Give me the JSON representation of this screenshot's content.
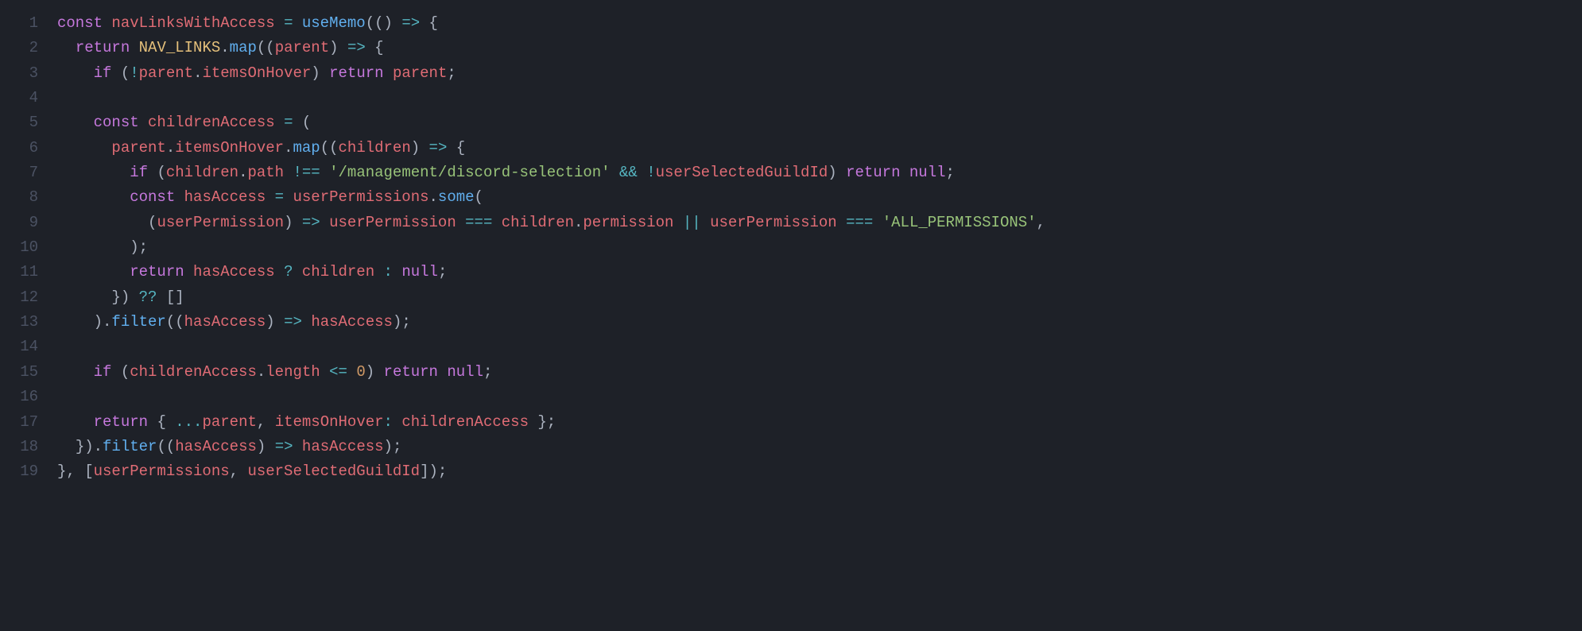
{
  "language": "javascript",
  "theme": "one-dark",
  "line_numbers": [
    "1",
    "2",
    "3",
    "4",
    "5",
    "6",
    "7",
    "8",
    "9",
    "10",
    "11",
    "12",
    "13",
    "14",
    "15",
    "16",
    "17",
    "18",
    "19"
  ],
  "tokens": [
    [
      {
        "c": "kw",
        "t": "const"
      },
      {
        "c": "plain",
        "t": " "
      },
      {
        "c": "var",
        "t": "navLinksWithAccess"
      },
      {
        "c": "plain",
        "t": " "
      },
      {
        "c": "op",
        "t": "="
      },
      {
        "c": "plain",
        "t": " "
      },
      {
        "c": "fn",
        "t": "useMemo"
      },
      {
        "c": "punc",
        "t": "(()"
      },
      {
        "c": "plain",
        "t": " "
      },
      {
        "c": "op",
        "t": "=>"
      },
      {
        "c": "plain",
        "t": " "
      },
      {
        "c": "punc",
        "t": "{"
      }
    ],
    [
      {
        "c": "plain",
        "t": "  "
      },
      {
        "c": "kw",
        "t": "return"
      },
      {
        "c": "plain",
        "t": " "
      },
      {
        "c": "prop",
        "t": "NAV_LINKS"
      },
      {
        "c": "punc",
        "t": "."
      },
      {
        "c": "fn",
        "t": "map"
      },
      {
        "c": "punc",
        "t": "(("
      },
      {
        "c": "var",
        "t": "parent"
      },
      {
        "c": "punc",
        "t": ")"
      },
      {
        "c": "plain",
        "t": " "
      },
      {
        "c": "op",
        "t": "=>"
      },
      {
        "c": "plain",
        "t": " "
      },
      {
        "c": "punc",
        "t": "{"
      }
    ],
    [
      {
        "c": "plain",
        "t": "    "
      },
      {
        "c": "kw",
        "t": "if"
      },
      {
        "c": "plain",
        "t": " "
      },
      {
        "c": "punc",
        "t": "("
      },
      {
        "c": "op",
        "t": "!"
      },
      {
        "c": "var",
        "t": "parent"
      },
      {
        "c": "punc",
        "t": "."
      },
      {
        "c": "var",
        "t": "itemsOnHover"
      },
      {
        "c": "punc",
        "t": ")"
      },
      {
        "c": "plain",
        "t": " "
      },
      {
        "c": "kw",
        "t": "return"
      },
      {
        "c": "plain",
        "t": " "
      },
      {
        "c": "var",
        "t": "parent"
      },
      {
        "c": "punc",
        "t": ";"
      }
    ],
    [
      {
        "c": "plain",
        "t": ""
      }
    ],
    [
      {
        "c": "plain",
        "t": "    "
      },
      {
        "c": "kw",
        "t": "const"
      },
      {
        "c": "plain",
        "t": " "
      },
      {
        "c": "var",
        "t": "childrenAccess"
      },
      {
        "c": "plain",
        "t": " "
      },
      {
        "c": "op",
        "t": "="
      },
      {
        "c": "plain",
        "t": " "
      },
      {
        "c": "punc",
        "t": "("
      }
    ],
    [
      {
        "c": "plain",
        "t": "      "
      },
      {
        "c": "var",
        "t": "parent"
      },
      {
        "c": "punc",
        "t": "."
      },
      {
        "c": "var",
        "t": "itemsOnHover"
      },
      {
        "c": "punc",
        "t": "."
      },
      {
        "c": "fn",
        "t": "map"
      },
      {
        "c": "punc",
        "t": "(("
      },
      {
        "c": "var",
        "t": "children"
      },
      {
        "c": "punc",
        "t": ")"
      },
      {
        "c": "plain",
        "t": " "
      },
      {
        "c": "op",
        "t": "=>"
      },
      {
        "c": "plain",
        "t": " "
      },
      {
        "c": "punc",
        "t": "{"
      }
    ],
    [
      {
        "c": "plain",
        "t": "        "
      },
      {
        "c": "kw",
        "t": "if"
      },
      {
        "c": "plain",
        "t": " "
      },
      {
        "c": "punc",
        "t": "("
      },
      {
        "c": "var",
        "t": "children"
      },
      {
        "c": "punc",
        "t": "."
      },
      {
        "c": "var",
        "t": "path"
      },
      {
        "c": "plain",
        "t": " "
      },
      {
        "c": "op",
        "t": "!=="
      },
      {
        "c": "plain",
        "t": " "
      },
      {
        "c": "str",
        "t": "'/management/discord-selection'"
      },
      {
        "c": "plain",
        "t": " "
      },
      {
        "c": "op",
        "t": "&&"
      },
      {
        "c": "plain",
        "t": " "
      },
      {
        "c": "op",
        "t": "!"
      },
      {
        "c": "var",
        "t": "userSelectedGuildId"
      },
      {
        "c": "punc",
        "t": ")"
      },
      {
        "c": "plain",
        "t": " "
      },
      {
        "c": "kw",
        "t": "return"
      },
      {
        "c": "plain",
        "t": " "
      },
      {
        "c": "kw",
        "t": "null"
      },
      {
        "c": "punc",
        "t": ";"
      }
    ],
    [
      {
        "c": "plain",
        "t": "        "
      },
      {
        "c": "kw",
        "t": "const"
      },
      {
        "c": "plain",
        "t": " "
      },
      {
        "c": "var",
        "t": "hasAccess"
      },
      {
        "c": "plain",
        "t": " "
      },
      {
        "c": "op",
        "t": "="
      },
      {
        "c": "plain",
        "t": " "
      },
      {
        "c": "var",
        "t": "userPermissions"
      },
      {
        "c": "punc",
        "t": "."
      },
      {
        "c": "fn",
        "t": "some"
      },
      {
        "c": "punc",
        "t": "("
      }
    ],
    [
      {
        "c": "plain",
        "t": "          "
      },
      {
        "c": "punc",
        "t": "("
      },
      {
        "c": "var",
        "t": "userPermission"
      },
      {
        "c": "punc",
        "t": ")"
      },
      {
        "c": "plain",
        "t": " "
      },
      {
        "c": "op",
        "t": "=>"
      },
      {
        "c": "plain",
        "t": " "
      },
      {
        "c": "var",
        "t": "userPermission"
      },
      {
        "c": "plain",
        "t": " "
      },
      {
        "c": "op",
        "t": "==="
      },
      {
        "c": "plain",
        "t": " "
      },
      {
        "c": "var",
        "t": "children"
      },
      {
        "c": "punc",
        "t": "."
      },
      {
        "c": "var",
        "t": "permission"
      },
      {
        "c": "plain",
        "t": " "
      },
      {
        "c": "op",
        "t": "||"
      },
      {
        "c": "plain",
        "t": " "
      },
      {
        "c": "var",
        "t": "userPermission"
      },
      {
        "c": "plain",
        "t": " "
      },
      {
        "c": "op",
        "t": "==="
      },
      {
        "c": "plain",
        "t": " "
      },
      {
        "c": "str",
        "t": "'ALL_PERMISSIONS'"
      },
      {
        "c": "punc",
        "t": ","
      }
    ],
    [
      {
        "c": "plain",
        "t": "        "
      },
      {
        "c": "punc",
        "t": ");"
      }
    ],
    [
      {
        "c": "plain",
        "t": "        "
      },
      {
        "c": "kw",
        "t": "return"
      },
      {
        "c": "plain",
        "t": " "
      },
      {
        "c": "var",
        "t": "hasAccess"
      },
      {
        "c": "plain",
        "t": " "
      },
      {
        "c": "op",
        "t": "?"
      },
      {
        "c": "plain",
        "t": " "
      },
      {
        "c": "var",
        "t": "children"
      },
      {
        "c": "plain",
        "t": " "
      },
      {
        "c": "op",
        "t": ":"
      },
      {
        "c": "plain",
        "t": " "
      },
      {
        "c": "kw",
        "t": "null"
      },
      {
        "c": "punc",
        "t": ";"
      }
    ],
    [
      {
        "c": "plain",
        "t": "      "
      },
      {
        "c": "punc",
        "t": "})"
      },
      {
        "c": "plain",
        "t": " "
      },
      {
        "c": "op",
        "t": "??"
      },
      {
        "c": "plain",
        "t": " "
      },
      {
        "c": "punc",
        "t": "[]"
      }
    ],
    [
      {
        "c": "plain",
        "t": "    "
      },
      {
        "c": "punc",
        "t": ")."
      },
      {
        "c": "fn",
        "t": "filter"
      },
      {
        "c": "punc",
        "t": "(("
      },
      {
        "c": "var",
        "t": "hasAccess"
      },
      {
        "c": "punc",
        "t": ")"
      },
      {
        "c": "plain",
        "t": " "
      },
      {
        "c": "op",
        "t": "=>"
      },
      {
        "c": "plain",
        "t": " "
      },
      {
        "c": "var",
        "t": "hasAccess"
      },
      {
        "c": "punc",
        "t": ");"
      }
    ],
    [
      {
        "c": "plain",
        "t": ""
      }
    ],
    [
      {
        "c": "plain",
        "t": "    "
      },
      {
        "c": "kw",
        "t": "if"
      },
      {
        "c": "plain",
        "t": " "
      },
      {
        "c": "punc",
        "t": "("
      },
      {
        "c": "var",
        "t": "childrenAccess"
      },
      {
        "c": "punc",
        "t": "."
      },
      {
        "c": "var",
        "t": "length"
      },
      {
        "c": "plain",
        "t": " "
      },
      {
        "c": "op",
        "t": "<="
      },
      {
        "c": "plain",
        "t": " "
      },
      {
        "c": "num",
        "t": "0"
      },
      {
        "c": "punc",
        "t": ")"
      },
      {
        "c": "plain",
        "t": " "
      },
      {
        "c": "kw",
        "t": "return"
      },
      {
        "c": "plain",
        "t": " "
      },
      {
        "c": "kw",
        "t": "null"
      },
      {
        "c": "punc",
        "t": ";"
      }
    ],
    [
      {
        "c": "plain",
        "t": ""
      }
    ],
    [
      {
        "c": "plain",
        "t": "    "
      },
      {
        "c": "kw",
        "t": "return"
      },
      {
        "c": "plain",
        "t": " "
      },
      {
        "c": "punc",
        "t": "{ "
      },
      {
        "c": "op",
        "t": "..."
      },
      {
        "c": "var",
        "t": "parent"
      },
      {
        "c": "punc",
        "t": ", "
      },
      {
        "c": "var",
        "t": "itemsOnHover"
      },
      {
        "c": "op",
        "t": ":"
      },
      {
        "c": "plain",
        "t": " "
      },
      {
        "c": "var",
        "t": "childrenAccess"
      },
      {
        "c": "punc",
        "t": " };"
      }
    ],
    [
      {
        "c": "plain",
        "t": "  "
      },
      {
        "c": "punc",
        "t": "})."
      },
      {
        "c": "fn",
        "t": "filter"
      },
      {
        "c": "punc",
        "t": "(("
      },
      {
        "c": "var",
        "t": "hasAccess"
      },
      {
        "c": "punc",
        "t": ")"
      },
      {
        "c": "plain",
        "t": " "
      },
      {
        "c": "op",
        "t": "=>"
      },
      {
        "c": "plain",
        "t": " "
      },
      {
        "c": "var",
        "t": "hasAccess"
      },
      {
        "c": "punc",
        "t": ");"
      }
    ],
    [
      {
        "c": "punc",
        "t": "}, ["
      },
      {
        "c": "var",
        "t": "userPermissions"
      },
      {
        "c": "punc",
        "t": ", "
      },
      {
        "c": "var",
        "t": "userSelectedGuildId"
      },
      {
        "c": "punc",
        "t": "]);"
      }
    ]
  ]
}
